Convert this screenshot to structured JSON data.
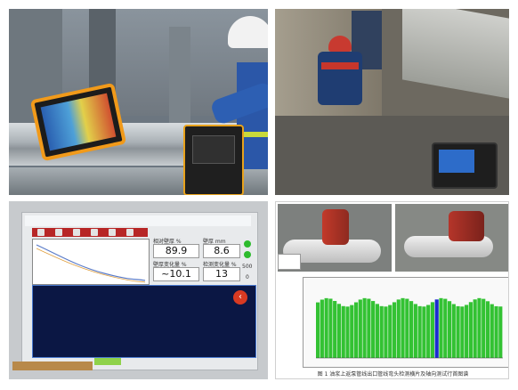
{
  "collage": {
    "panels": [
      {
        "id": "field-tablet-photo",
        "kind": "photo"
      },
      {
        "id": "field-workers-photo",
        "kind": "photo"
      },
      {
        "id": "instrument-screen-photo",
        "kind": "photo"
      },
      {
        "id": "figure-with-chart",
        "kind": "figure"
      }
    ]
  },
  "instrument": {
    "title_bar": "",
    "readings": [
      {
        "label": "相对壁厚 %",
        "value": "89.9"
      },
      {
        "label": "壁厚 mm",
        "value": "8.6"
      },
      {
        "label": "壁厚变化量 %",
        "value": "~10.1"
      },
      {
        "label": "检测变化量 %",
        "value": "13"
      }
    ],
    "side_values": [
      "500",
      "0"
    ],
    "close_glyph": "‹"
  },
  "figure": {
    "caption": "图 1  油浆上返泵管线出口管线弯头检测横片及轴向测试行首图谱",
    "chart_data": {
      "type": "bar",
      "categories": [],
      "values": [],
      "title": "",
      "xlabel": "",
      "ylabel": ""
    }
  },
  "colors": {
    "tablet_frame": "#f19a1a",
    "instrument_toolbar": "#b72626",
    "dark_panel": "#0b1744",
    "bar_green": "#33c233",
    "bar_blue": "#1a2bd0"
  }
}
